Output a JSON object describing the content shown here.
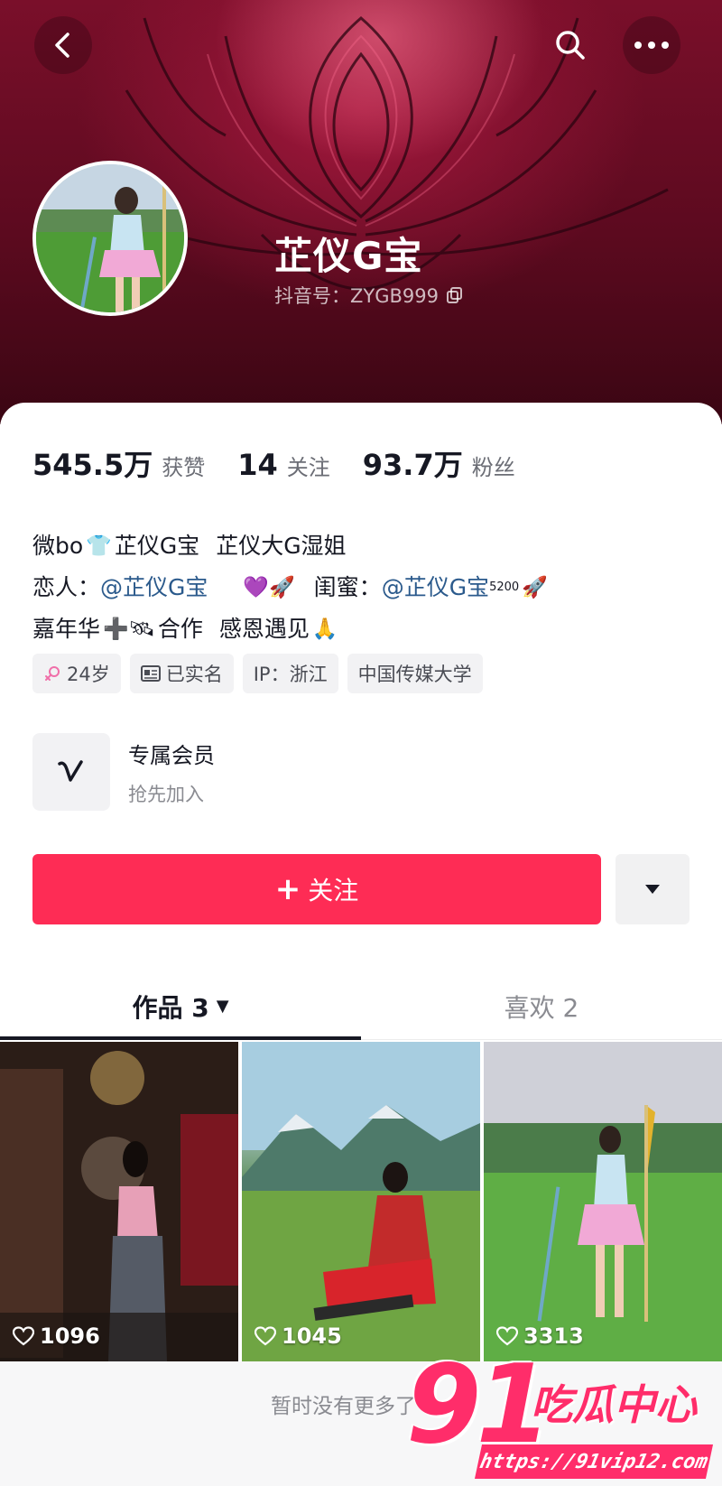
{
  "header": {
    "back_icon": "chevron-left-icon",
    "search_icon": "search-icon",
    "more_icon": "more-horizontal-icon"
  },
  "profile": {
    "name": "芷仪G宝",
    "douyin_id": "抖音号：ZYGB999",
    "copy_icon": "copy-icon"
  },
  "stats": [
    {
      "value": "545.5万",
      "label": "获赞"
    },
    {
      "value": "14",
      "label": "关注"
    },
    {
      "value": "93.7万",
      "label": "粉丝"
    }
  ],
  "bio": {
    "line1": {
      "prefix": "微bo",
      "emoji": "👕",
      "part1": "芷仪G宝",
      "part2": "芷仪大G湿姐"
    },
    "line2": {
      "label1": "恋人：",
      "mention1": "@芷仪G宝",
      "emoji1": "💜🚀",
      "label2": "闺蜜：",
      "mention2": "@芷仪G宝",
      "sup": "5200",
      "emoji2": "🚀"
    },
    "line3": {
      "part1": "嘉年华",
      "emoji1": "➕🛰",
      "part2": "合作",
      "part3": "感恩遇见",
      "emoji2": "🙏"
    }
  },
  "tags": [
    {
      "icon": "female-icon",
      "label": "24岁"
    },
    {
      "icon": "id-card-icon",
      "label": "已实名"
    },
    {
      "icon": "",
      "label": "IP：浙江"
    },
    {
      "icon": "",
      "label": "中国传媒大学"
    }
  ],
  "vip": {
    "title": "专属会员",
    "subtitle": "抢先加入",
    "icon": "v-logo-icon"
  },
  "actions": {
    "follow_label": "关注",
    "follow_plus": "+",
    "dropdown_icon": "triangle-down-icon"
  },
  "tabs": [
    {
      "label": "作品 3",
      "active": true
    },
    {
      "label": "喜欢 2",
      "active": false
    }
  ],
  "videos": [
    {
      "likes": "1096"
    },
    {
      "likes": "1045"
    },
    {
      "likes": "3313"
    }
  ],
  "footer": {
    "no_more": "暂时没有更多了"
  },
  "watermark": {
    "number": "91",
    "text": "吃瓜中心",
    "url": "https://91vip12.com"
  },
  "colors": {
    "accent": "#fe2c55",
    "mention": "#2b5a8c",
    "banner": "#7a0f2a"
  }
}
